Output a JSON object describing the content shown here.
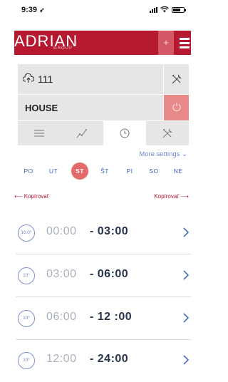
{
  "status_bar": {
    "time": "9:39",
    "location_glyph": "➶"
  },
  "header": {
    "logo": "ADRIAN",
    "logo_sub": "GROUP",
    "plus": "+"
  },
  "device": {
    "id": "111",
    "name": "HOUSE"
  },
  "tabs": [
    "list",
    "chart",
    "clock",
    "tools"
  ],
  "more_settings": "More settings ⌄",
  "days": [
    "PO",
    "UT",
    "ST",
    "ŠT",
    "PI",
    "SO",
    "NE"
  ],
  "active_day": "ST",
  "copy_left": "⟵ Kopírovať",
  "copy_right": "Kopírovať ⟶",
  "schedule": [
    {
      "temp": "10.0°",
      "start": "00:00",
      "end": "- 03:00"
    },
    {
      "temp": "10°",
      "start": "03:00",
      "end": "- 06:00"
    },
    {
      "temp": "10°",
      "start": "06:00",
      "end": "- 12 :00"
    },
    {
      "temp": "10°",
      "start": "12:00",
      "end": "- 24:00"
    }
  ],
  "colors": {
    "brand": "#b5182f",
    "accent": "#3b5fc4",
    "active_day": "#e26a6a"
  }
}
